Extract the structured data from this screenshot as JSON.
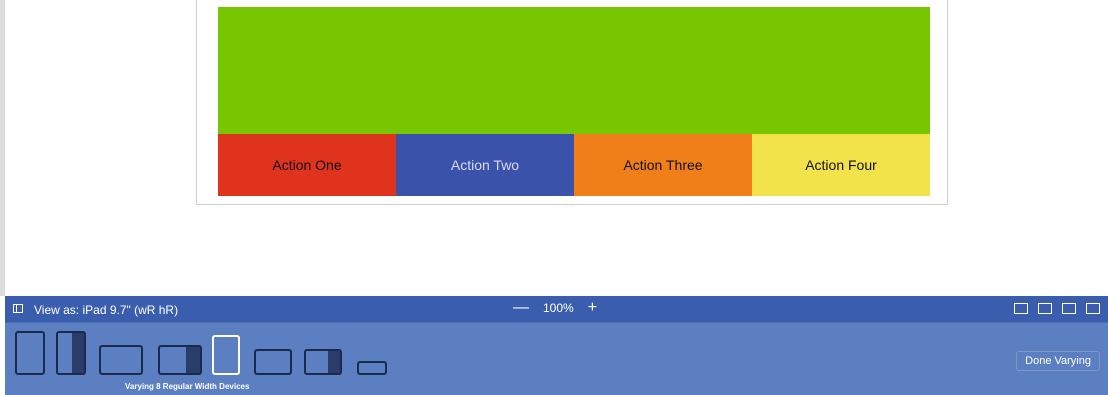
{
  "canvas": {
    "green_color": "#78c600",
    "actions": [
      {
        "label": "Action One",
        "bg": "#e0331e",
        "fg": "#111111"
      },
      {
        "label": "Action Two",
        "bg": "#3a52aa",
        "fg": "#d7dcef"
      },
      {
        "label": "Action Three",
        "bg": "#f07f1a",
        "fg": "#111111"
      },
      {
        "label": "Action Four",
        "bg": "#f3e34a",
        "fg": "#111111"
      }
    ]
  },
  "toolbar": {
    "view_as": "View as: iPad 9.7\" (wR hR)",
    "zoom_out": "—",
    "zoom_level": "100%",
    "zoom_in": "+",
    "bg": "#3a5ead"
  },
  "devices": {
    "bg": "#5b7fc0",
    "varying_label": "Varying 8 Regular Width Devices",
    "done_label": "Done Varying"
  }
}
